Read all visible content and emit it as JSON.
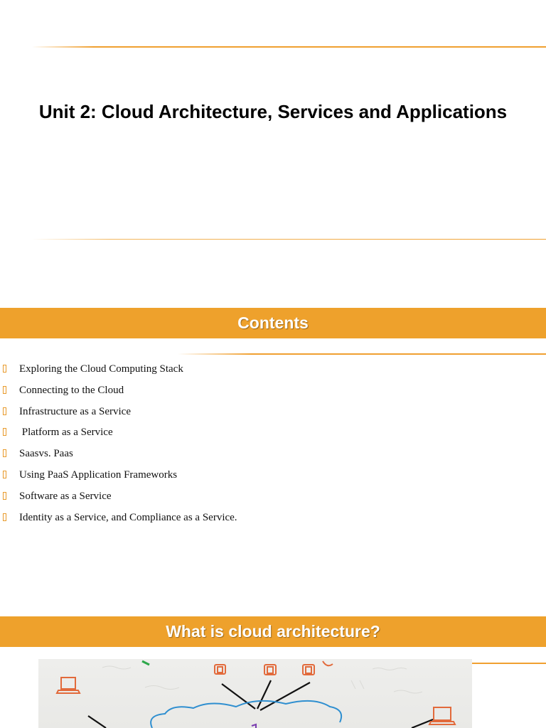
{
  "slide1": {
    "title": "Unit 2: Cloud Architecture, Services and Applications"
  },
  "slide2": {
    "heading": "Contents",
    "items": [
      "Exploring the Cloud Computing Stack",
      "Connecting to the Cloud",
      "Infrastructure as a Service",
      " Platform as a Service",
      "Saasvs. Paas",
      "Using PaaS Application Frameworks",
      "Software as a Service",
      "Identity as a Service, and Compliance as a Service."
    ]
  },
  "slide3": {
    "heading": "What is cloud architecture?"
  },
  "colors": {
    "accent": "#eea12c",
    "bullet": "#e89a2a"
  }
}
